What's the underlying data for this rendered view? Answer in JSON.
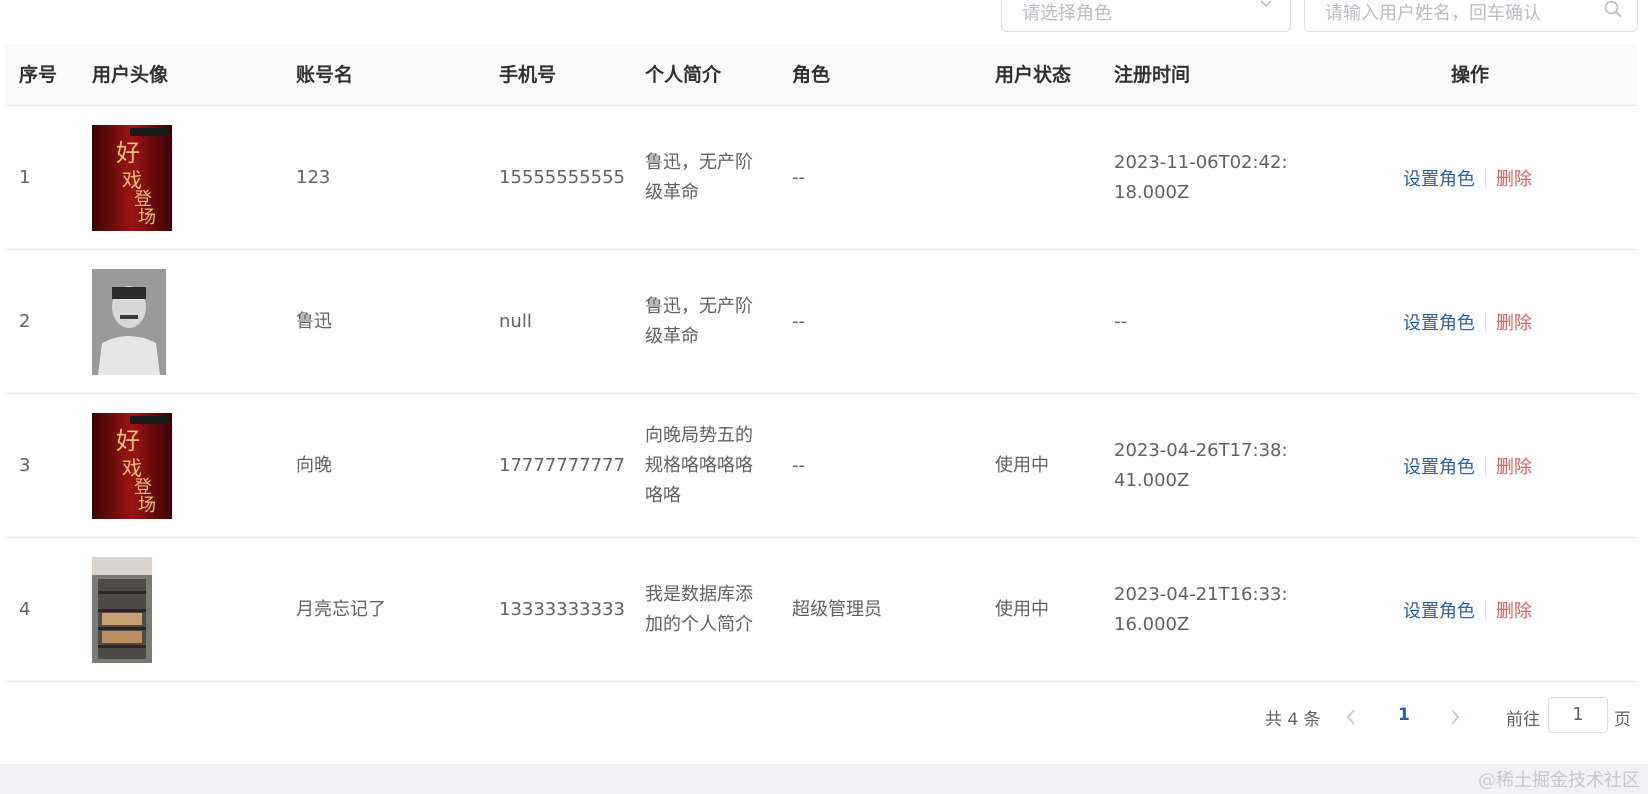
{
  "filters": {
    "role_placeholder": "请选择角色",
    "search_placeholder": "请输入用户姓名，回车确认"
  },
  "table": {
    "headers": {
      "index": "序号",
      "avatar": "用户头像",
      "account": "账号名",
      "phone": "手机号",
      "bio": "个人简介",
      "role": "角色",
      "status": "用户状态",
      "register_time": "注册时间",
      "actions": "操作"
    },
    "rows": [
      {
        "index": "1",
        "avatar_desc": "poster-good-show",
        "account": "123",
        "phone": "15555555555",
        "bio": "鲁迅，无产阶级革命",
        "role": "--",
        "status": "",
        "register_time": "2023-11-06T02:42:18.000Z"
      },
      {
        "index": "2",
        "avatar_desc": "portrait-bw",
        "account": "鲁迅",
        "phone": "null",
        "bio": "鲁迅，无产阶级革命",
        "role": "--",
        "status": "",
        "register_time": "--"
      },
      {
        "index": "3",
        "avatar_desc": "poster-good-show",
        "account": "向晚",
        "phone": "17777777777",
        "bio": "向晚局势五的规格咯咯咯咯咯咯",
        "role": "--",
        "status": "使用中",
        "register_time": "2023-04-26T17:38:41.000Z"
      },
      {
        "index": "4",
        "avatar_desc": "photo-bakery-rack",
        "account": "月亮忘记了",
        "phone": "13333333333",
        "bio": "我是数据库添加的个人简介",
        "role": "超级管理员",
        "status": "使用中",
        "register_time": "2023-04-21T16:33:16.000Z"
      }
    ],
    "action_labels": {
      "set_role": "设置角色",
      "delete": "删除"
    }
  },
  "pagination": {
    "total_text": "共 4 条",
    "current_page": "1",
    "goto_label": "前往",
    "goto_value": "1",
    "page_unit": "页"
  },
  "watermark": "@稀土掘金技术社区",
  "colors": {
    "link": "#2d5ea8",
    "danger": "#e25c5c",
    "header_bg": "#fafafa",
    "border": "#ebeef5"
  }
}
